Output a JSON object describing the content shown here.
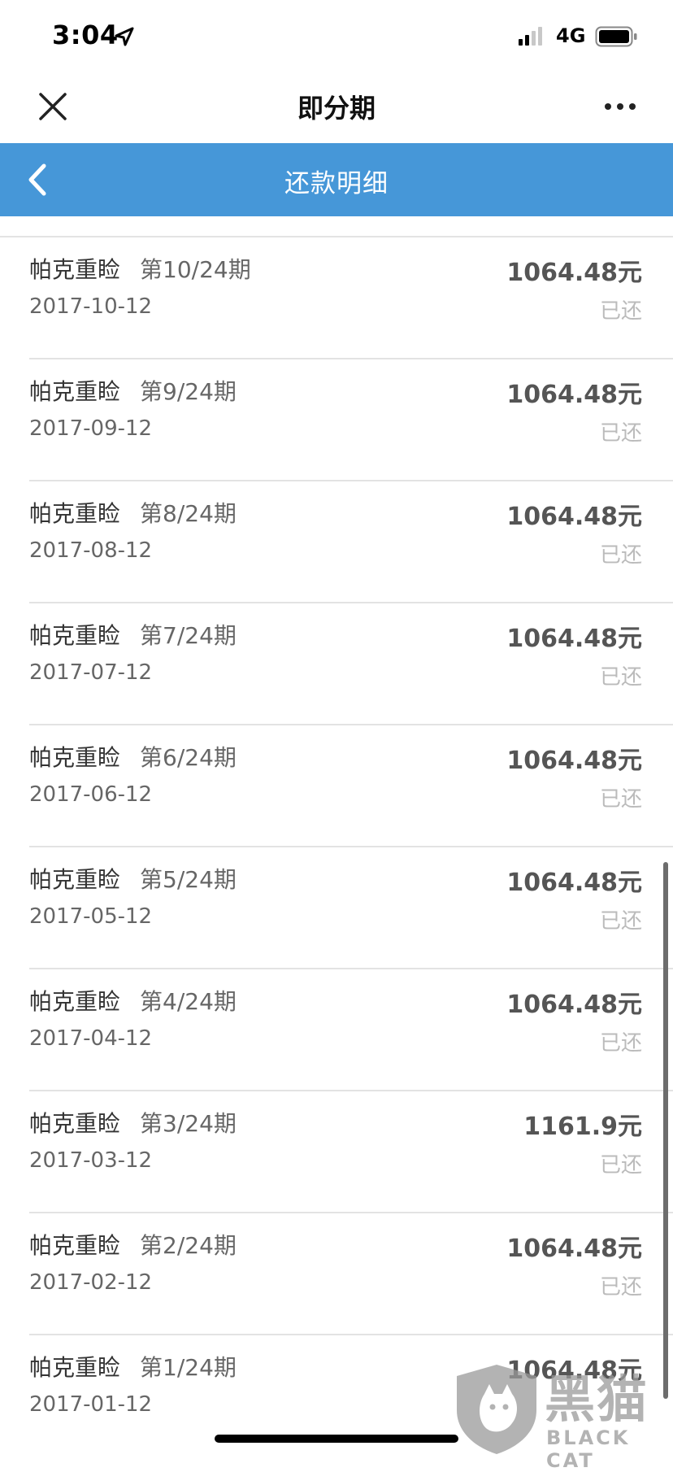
{
  "status_bar": {
    "time": "3:04",
    "network": "4G",
    "icons": [
      "location-arrow-icon",
      "signal-icon",
      "battery-icon"
    ]
  },
  "title_bar": {
    "title": "即分期",
    "icons": [
      "close-icon",
      "more-icon"
    ]
  },
  "header": {
    "title": "还款明细",
    "color": "#4697d8",
    "icons": [
      "back-arrow-icon"
    ]
  },
  "records": [
    {
      "name": "帕克重睑",
      "period": "第10/24期",
      "date": "2017-10-12",
      "amount": "1064.48元",
      "status": "已还"
    },
    {
      "name": "帕克重睑",
      "period": "第9/24期",
      "date": "2017-09-12",
      "amount": "1064.48元",
      "status": "已还"
    },
    {
      "name": "帕克重睑",
      "period": "第8/24期",
      "date": "2017-08-12",
      "amount": "1064.48元",
      "status": "已还"
    },
    {
      "name": "帕克重睑",
      "period": "第7/24期",
      "date": "2017-07-12",
      "amount": "1064.48元",
      "status": "已还"
    },
    {
      "name": "帕克重睑",
      "period": "第6/24期",
      "date": "2017-06-12",
      "amount": "1064.48元",
      "status": "已还"
    },
    {
      "name": "帕克重睑",
      "period": "第5/24期",
      "date": "2017-05-12",
      "amount": "1064.48元",
      "status": "已还"
    },
    {
      "name": "帕克重睑",
      "period": "第4/24期",
      "date": "2017-04-12",
      "amount": "1064.48元",
      "status": "已还"
    },
    {
      "name": "帕克重睑",
      "period": "第3/24期",
      "date": "2017-03-12",
      "amount": "1161.9元",
      "status": "已还"
    },
    {
      "name": "帕克重睑",
      "period": "第2/24期",
      "date": "2017-02-12",
      "amount": "1064.48元",
      "status": "已还"
    },
    {
      "name": "帕克重睑",
      "period": "第1/24期",
      "date": "2017-01-12",
      "amount": "1064.48元",
      "status": ""
    }
  ],
  "watermark": {
    "text_cn": "黑猫",
    "text_en": "BLACK CAT"
  }
}
